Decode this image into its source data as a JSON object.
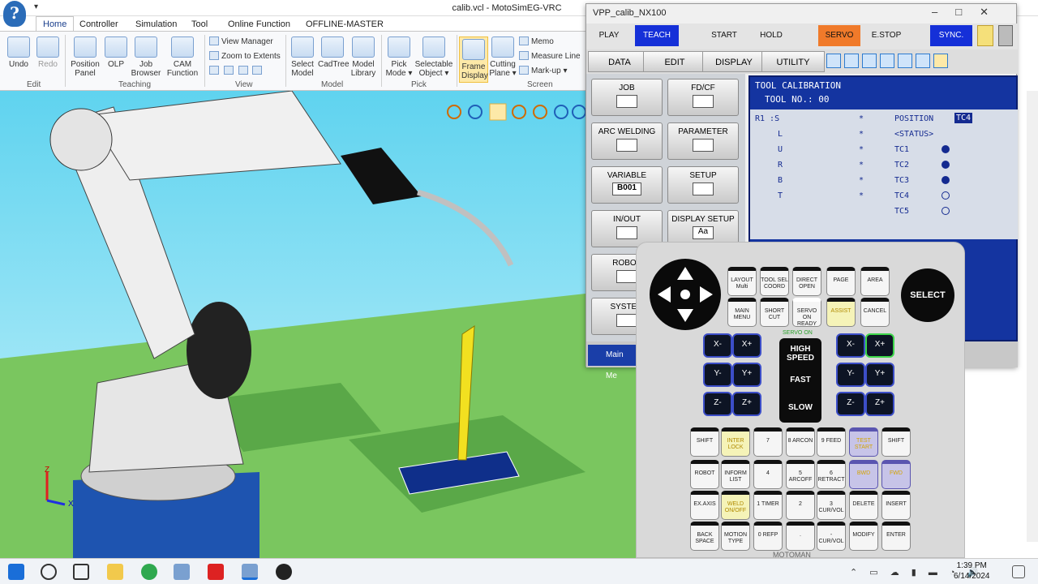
{
  "app": {
    "title": "calib.vcl - MotoSimEG-VRC",
    "icon": "help-icon"
  },
  "quick_access": "▾",
  "ribbon": {
    "tabs": [
      "Home",
      "Controller",
      "Simulation",
      "Tool",
      "Online Function",
      "OFFLINE-MASTER"
    ],
    "active_tab": "Home",
    "undo": "Undo",
    "redo": "Redo",
    "edit_group": "Edit",
    "position_panel": "Position Panel",
    "olp": "OLP",
    "job_browser": "Job Browser",
    "cam_function": "CAM Function",
    "teaching_group": "Teaching",
    "view_manager": "View Manager",
    "zoom_extents": "Zoom to Extents",
    "view_group": "View",
    "select_model": "Select Model",
    "cadtree": "CadTree",
    "model_library": "Model Library",
    "model_group": "Model",
    "pick_mode": "Pick Mode ▾",
    "selectable_object": "Selectable Object ▾",
    "pick_group": "Pick",
    "frame_display": "Frame Display",
    "cutting_plane": "Cutting Plane ▾",
    "memo": "Memo",
    "measure_line": "Measure Line",
    "markup": "Mark-up ▾",
    "screen_group": "Screen"
  },
  "viewport": {
    "axis_z": "Z",
    "axis_x": "X"
  },
  "pendant_window": {
    "title": "VPP_calib_NX100",
    "play": "PLAY",
    "teach": "TEACH",
    "start": "START",
    "hold": "HOLD",
    "servo_on": "SERVO ON",
    "estop": "E.STOP",
    "sync": "SYNC.",
    "data": "DATA",
    "edit": "EDIT",
    "display": "DISPLAY",
    "utility": "UTILITY",
    "main_menu": "Main Me",
    "menu": [
      {
        "label": "JOB",
        "sub": "JOB"
      },
      {
        "label": "FD/CF",
        "sub": ""
      },
      {
        "label": "ARC WELDING",
        "sub": ""
      },
      {
        "label": "PARAMETER",
        "sub": ""
      },
      {
        "label": "VARIABLE",
        "sub": "B001"
      },
      {
        "label": "SETUP",
        "sub": ""
      },
      {
        "label": "IN/OUT",
        "sub": ""
      },
      {
        "label": "DISPLAY SETUP",
        "sub": "Aa"
      },
      {
        "label": "ROBOT",
        "sub": ""
      },
      {
        "label": "SYSTEM",
        "sub": ""
      }
    ]
  },
  "screen": {
    "title": "TOOL CALIBRATION",
    "tool_no": "TOOL NO.: 00",
    "axes": [
      "R1 :S",
      "L",
      "U",
      "R",
      "B",
      "T"
    ],
    "star": "*",
    "position": "POSITION",
    "position_val": "TC4",
    "status": "<STATUS>",
    "tcs": [
      {
        "name": "TC1",
        "set": true
      },
      {
        "name": "TC2",
        "set": true
      },
      {
        "name": "TC3",
        "set": true
      },
      {
        "name": "TC4",
        "set": false
      },
      {
        "name": "TC5",
        "set": false
      }
    ]
  },
  "pendant": {
    "select": "SELECT",
    "top_keys": [
      "LAYOUT Multi",
      "TOOL SEL COORD",
      "DIRECT OPEN",
      "PAGE",
      "AREA"
    ],
    "row2": [
      "MAIN MENU",
      "SHORT CUT",
      "SERVO ON READY",
      "ASSIST",
      "CANCEL"
    ],
    "servo_on_label": "SERVO ON",
    "jog_left": [
      "X-",
      "X+",
      "Y-",
      "Y+",
      "Z-",
      "Z+"
    ],
    "jog_right": [
      "X-",
      "X+",
      "Y-",
      "Y+",
      "Z-",
      "Z+"
    ],
    "high_speed": "HIGH SPEED",
    "fast": "FAST",
    "slow": "SLOW",
    "keys": [
      [
        "SHIFT",
        "INTER LOCK",
        "7",
        "8 ARCON",
        "9 FEED",
        "TEST START",
        "SHIFT"
      ],
      [
        "ROBOT",
        "INFORM LIST",
        "4",
        "5 ARCOFF",
        "6 RETRACT",
        "BWD",
        "FWD"
      ],
      [
        "EX.AXIS",
        "WELD ON/OFF",
        "1 TIMER",
        "2",
        "3 CUR/VOL",
        "DELETE",
        "INSERT"
      ],
      [
        "BACK SPACE",
        "MOTION TYPE",
        "0 REFP",
        ".",
        "- CUR/VOL",
        "MODIFY",
        "ENTER"
      ]
    ],
    "brand": "MOTOMAN"
  },
  "taskbar": {
    "time": "1:39 PM",
    "date": "6/14/2024"
  }
}
